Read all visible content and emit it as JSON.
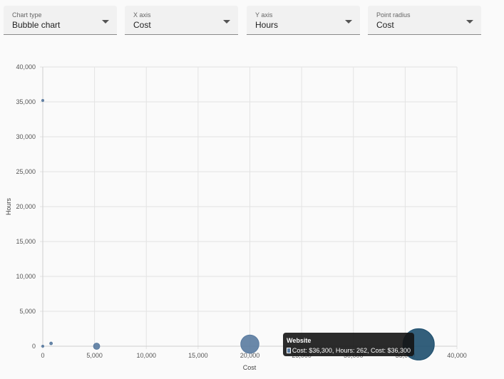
{
  "controls": {
    "chart_type": {
      "label": "Chart type",
      "value": "Bubble chart"
    },
    "x_axis": {
      "label": "X axis",
      "value": "Cost"
    },
    "y_axis": {
      "label": "Y axis",
      "value": "Hours"
    },
    "point_radius": {
      "label": "Point radius",
      "value": "Cost"
    }
  },
  "tooltip": {
    "title": "Website",
    "line": "Cost: $36,300, Hours: 262, Cost: $36,300",
    "swatch_color": "#5a7ba0"
  },
  "chart_data": {
    "type": "scatter",
    "variant": "bubble",
    "xlabel": "Cost",
    "ylabel": "Hours",
    "xlim": [
      0,
      40000
    ],
    "ylim": [
      0,
      40000
    ],
    "x_ticks": [
      "0",
      "5,000",
      "10,000",
      "15,000",
      "20,000",
      "25,000",
      "30,000",
      "35,000",
      "40,000"
    ],
    "y_ticks": [
      "0",
      "5,000",
      "10,000",
      "15,000",
      "20,000",
      "25,000",
      "30,000",
      "35,000",
      "40,000"
    ],
    "grid": true,
    "points": [
      {
        "x": 0,
        "y": 35200,
        "r": 0.0,
        "highlighted": false
      },
      {
        "x": 0,
        "y": 0,
        "r": 0.0,
        "highlighted": false
      },
      {
        "x": 800,
        "y": 400,
        "r": 0.02,
        "highlighted": false
      },
      {
        "x": 5200,
        "y": 0,
        "r": 0.14,
        "highlighted": false
      },
      {
        "x": 20000,
        "y": 300,
        "r": 0.55,
        "highlighted": false
      },
      {
        "x": 36300,
        "y": 262,
        "r": 1.0,
        "highlighted": true
      }
    ],
    "point_color": "#5a7ba0",
    "point_alpha": 0.9,
    "highlight_color": "#1d4e6d"
  }
}
